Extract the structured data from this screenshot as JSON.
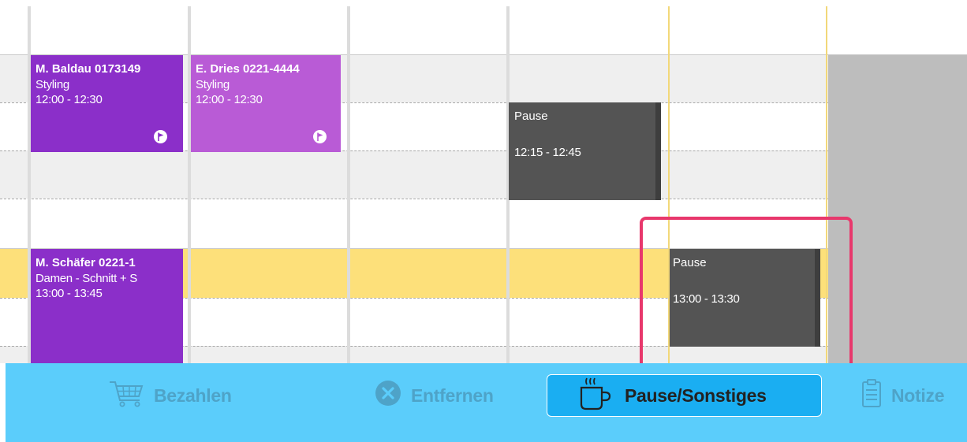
{
  "appointments": [
    {
      "name": "M. Baldau 0173149",
      "service": "Styling",
      "time": "12:00 - 12:30",
      "color": "#8b2fc9"
    },
    {
      "name": "E. Dries 0221-4444",
      "service": "Styling",
      "time": "12:00 - 12:30",
      "color": "#b95bd6"
    },
    {
      "name": "M. Schäfer 0221-1",
      "service": "Damen - Schnitt + S",
      "time": "13:00 - 13:45",
      "color": "#8b2fc9"
    }
  ],
  "pauses": [
    {
      "title": "Pause",
      "time": "12:15 - 12:45"
    },
    {
      "title": "Pause",
      "time": "13:00 - 13:30"
    }
  ],
  "toolbar": {
    "items": [
      {
        "label": "Bezahlen",
        "icon": "cart-icon",
        "state": "disabled"
      },
      {
        "label": "Entfernen",
        "icon": "remove-circle-icon",
        "state": "disabled"
      },
      {
        "label": "Pause/Sonstiges",
        "icon": "coffee-cup-icon",
        "state": "active"
      },
      {
        "label": "Notize",
        "icon": "clipboard-icon",
        "state": "disabled"
      }
    ]
  },
  "colors": {
    "highlight_border": "#e8386c",
    "toolbar_bg": "#5bcdfb",
    "selected_row": "#fde07a",
    "pause_bg": "#545454"
  }
}
